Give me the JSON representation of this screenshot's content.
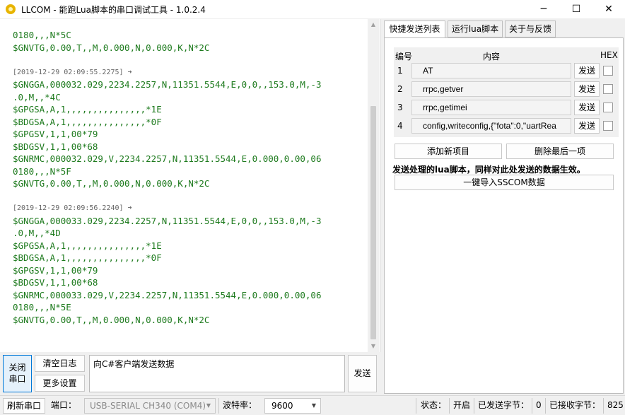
{
  "window": {
    "title": "LLCOM - 能跑Lua脚本的串口调试工具 - 1.0.2.4",
    "minimize_glyph": "─",
    "maximize_glyph": "☐",
    "close_glyph": "✕"
  },
  "log": {
    "lines": [
      {
        "kind": "data",
        "text": "0180,,,N*5C"
      },
      {
        "kind": "data",
        "text": "$GNVTG,0.00,T,,M,0.000,N,0.000,K,N*2C"
      },
      {
        "kind": "gap",
        "text": ""
      },
      {
        "kind": "ts",
        "text": "[2019-12-29 02:09:55.2275] ➜"
      },
      {
        "kind": "data",
        "text": "$GNGGA,000032.029,2234.2257,N,11351.5544,E,0,0,,153.0,M,-3"
      },
      {
        "kind": "data",
        "text": ".0,M,,*4C"
      },
      {
        "kind": "data",
        "text": "$GPGSA,A,1,,,,,,,,,,,,,,,*1E"
      },
      {
        "kind": "data",
        "text": "$BDGSA,A,1,,,,,,,,,,,,,,,*0F"
      },
      {
        "kind": "data",
        "text": "$GPGSV,1,1,00*79"
      },
      {
        "kind": "data",
        "text": "$BDGSV,1,1,00*68"
      },
      {
        "kind": "data",
        "text": "$GNRMC,000032.029,V,2234.2257,N,11351.5544,E,0.000,0.00,06"
      },
      {
        "kind": "data",
        "text": "0180,,,N*5F"
      },
      {
        "kind": "data",
        "text": "$GNVTG,0.00,T,,M,0.000,N,0.000,K,N*2C"
      },
      {
        "kind": "gap",
        "text": ""
      },
      {
        "kind": "ts",
        "text": "[2019-12-29 02:09:56.2240] ➜"
      },
      {
        "kind": "data",
        "text": "$GNGGA,000033.029,2234.2257,N,11351.5544,E,0,0,,153.0,M,-3"
      },
      {
        "kind": "data",
        "text": ".0,M,,*4D"
      },
      {
        "kind": "data",
        "text": "$GPGSA,A,1,,,,,,,,,,,,,,,*1E"
      },
      {
        "kind": "data",
        "text": "$BDGSA,A,1,,,,,,,,,,,,,,,*0F"
      },
      {
        "kind": "data",
        "text": "$GPGSV,1,1,00*79"
      },
      {
        "kind": "data",
        "text": "$BDGSV,1,1,00*68"
      },
      {
        "kind": "data",
        "text": "$GNRMC,000033.029,V,2234.2257,N,11351.5544,E,0.000,0.00,06"
      },
      {
        "kind": "data",
        "text": "0180,,,N*5E"
      },
      {
        "kind": "data",
        "text": "$GNVTG,0.00,T,,M,0.000,N,0.000,K,N*2C"
      }
    ],
    "scroll_up_glyph": "▲",
    "scroll_down_glyph": "▼"
  },
  "tabs": [
    "快捷发送列表",
    "运行lua脚本",
    "关于与反馈"
  ],
  "quick_send": {
    "col_num": "编号",
    "col_content": "内容",
    "col_hex": "HEX",
    "send_label": "发送",
    "rows": [
      {
        "num": "1",
        "content": "AT"
      },
      {
        "num": "2",
        "content": "rrpc,getver"
      },
      {
        "num": "3",
        "content": "rrpc,getimei"
      },
      {
        "num": "4",
        "content": "config,writeconfig,{\"fota\":0,\"uartRea"
      }
    ],
    "add_label": "添加新项目",
    "delete_label": "删除最后一项",
    "hint": "发送处理的lua脚本，同样对此处发送的数据生效。",
    "import_label": "一键导入SSCOM数据"
  },
  "controls": {
    "close_port_line1": "关闭",
    "close_port_line2": "串口",
    "clear_log": "清空日志",
    "more_settings": "更多设置",
    "send_text": "向C#客户端发送数据",
    "send_button": "发送"
  },
  "statusbar": {
    "refresh": "刷新串口",
    "port_label": "端口：",
    "port_value": "USB-SERIAL CH340 (COM4)",
    "baud_label": "波特率：",
    "baud_value": "9600",
    "status_label": "状态：",
    "status_value": "开启",
    "sent_label": "已发送字节：",
    "sent_value": "0",
    "recv_label": "已接收字节：",
    "recv_value": "825",
    "caret_glyph": "▼"
  }
}
